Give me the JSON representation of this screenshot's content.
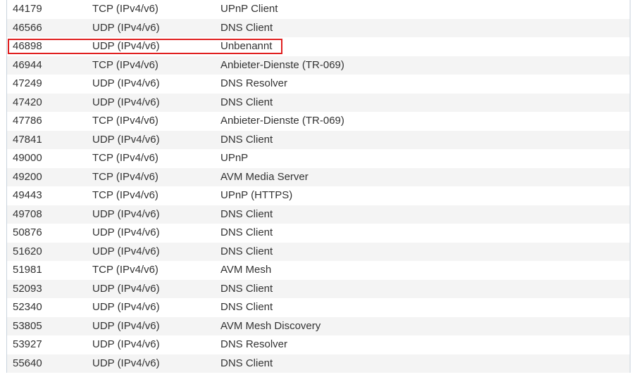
{
  "port_table": {
    "rows": [
      {
        "port": "44179",
        "protocol": "TCP (IPv4/v6)",
        "service": "UPnP Client"
      },
      {
        "port": "46566",
        "protocol": "UDP (IPv4/v6)",
        "service": "DNS Client"
      },
      {
        "port": "46898",
        "protocol": "UDP (IPv4/v6)",
        "service": "Unbenannt"
      },
      {
        "port": "46944",
        "protocol": "TCP (IPv4/v6)",
        "service": "Anbieter-Dienste (TR-069)"
      },
      {
        "port": "47249",
        "protocol": "UDP (IPv4/v6)",
        "service": "DNS Resolver"
      },
      {
        "port": "47420",
        "protocol": "UDP (IPv4/v6)",
        "service": "DNS Client"
      },
      {
        "port": "47786",
        "protocol": "TCP (IPv4/v6)",
        "service": "Anbieter-Dienste (TR-069)"
      },
      {
        "port": "47841",
        "protocol": "UDP (IPv4/v6)",
        "service": "DNS Client"
      },
      {
        "port": "49000",
        "protocol": "TCP (IPv4/v6)",
        "service": "UPnP"
      },
      {
        "port": "49200",
        "protocol": "TCP (IPv4/v6)",
        "service": "AVM Media Server"
      },
      {
        "port": "49443",
        "protocol": "TCP (IPv4/v6)",
        "service": "UPnP (HTTPS)"
      },
      {
        "port": "49708",
        "protocol": "UDP (IPv4/v6)",
        "service": "DNS Client"
      },
      {
        "port": "50876",
        "protocol": "UDP (IPv4/v6)",
        "service": "DNS Client"
      },
      {
        "port": "51620",
        "protocol": "UDP (IPv4/v6)",
        "service": "DNS Client"
      },
      {
        "port": "51981",
        "protocol": "TCP (IPv4/v6)",
        "service": "AVM Mesh"
      },
      {
        "port": "52093",
        "protocol": "UDP (IPv4/v6)",
        "service": "DNS Client"
      },
      {
        "port": "52340",
        "protocol": "UDP (IPv4/v6)",
        "service": "DNS Client"
      },
      {
        "port": "53805",
        "protocol": "UDP (IPv4/v6)",
        "service": "AVM Mesh Discovery"
      },
      {
        "port": "53927",
        "protocol": "UDP (IPv4/v6)",
        "service": "DNS Resolver"
      },
      {
        "port": "55640",
        "protocol": "UDP (IPv4/v6)",
        "service": "DNS Client"
      }
    ]
  },
  "highlight": {
    "row_index": 2,
    "color": "#e02020"
  }
}
